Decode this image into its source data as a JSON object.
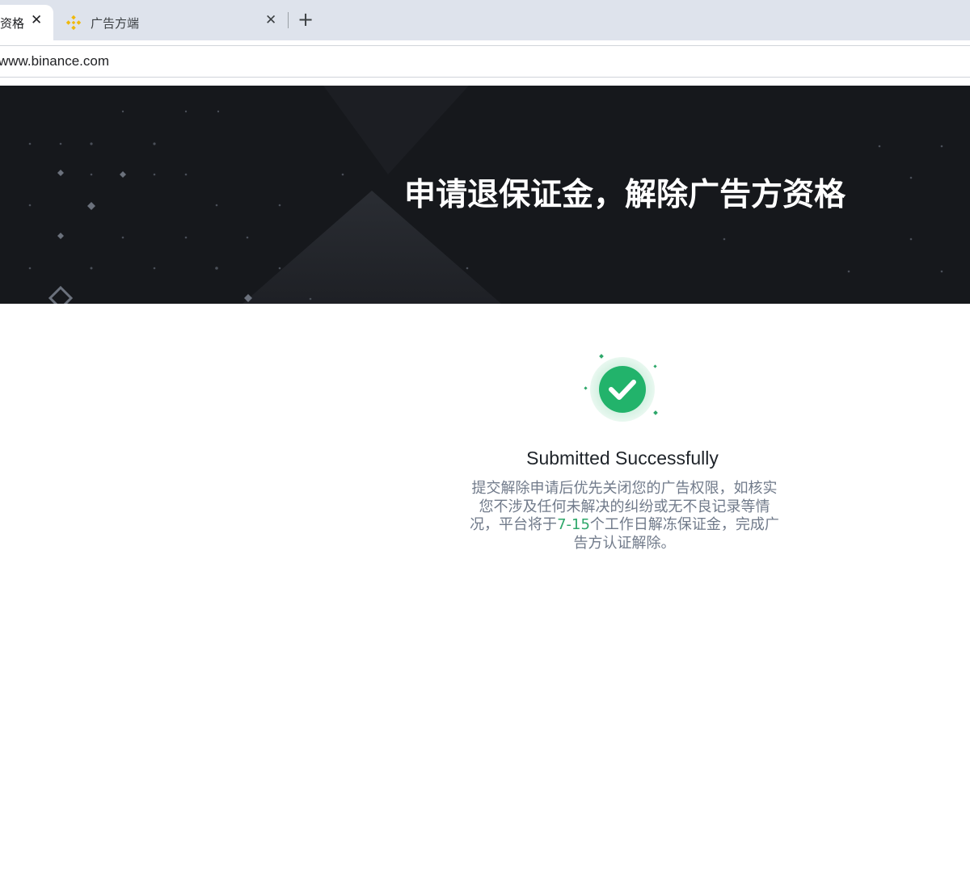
{
  "browser": {
    "tabs": [
      {
        "label": "资格",
        "active": true,
        "close_icon": "close-icon"
      },
      {
        "label": "广告方端",
        "active": false,
        "favicon": "binance-logo-icon",
        "close_icon": "close-icon"
      }
    ],
    "new_tab_label": "+",
    "url": "www.binance.com"
  },
  "hero": {
    "title": "申请退保证金，解除广告方资格"
  },
  "result": {
    "icon": "check-circle-icon",
    "title": "Submitted Successfully",
    "description_before": "提交解除申请后优先关闭您的广告权限，如核实您不涉及任何未解决的纠纷或无不良记录等情况，平台将于",
    "description_highlight": "7-15",
    "description_after": "个工作日解冻保证金，完成广告方认证解除。"
  },
  "colors": {
    "success_green": "#2ea76a",
    "hero_bg": "#16181c",
    "tab_strip_bg": "#dee3ec",
    "binance_yellow": "#f0b90b"
  }
}
